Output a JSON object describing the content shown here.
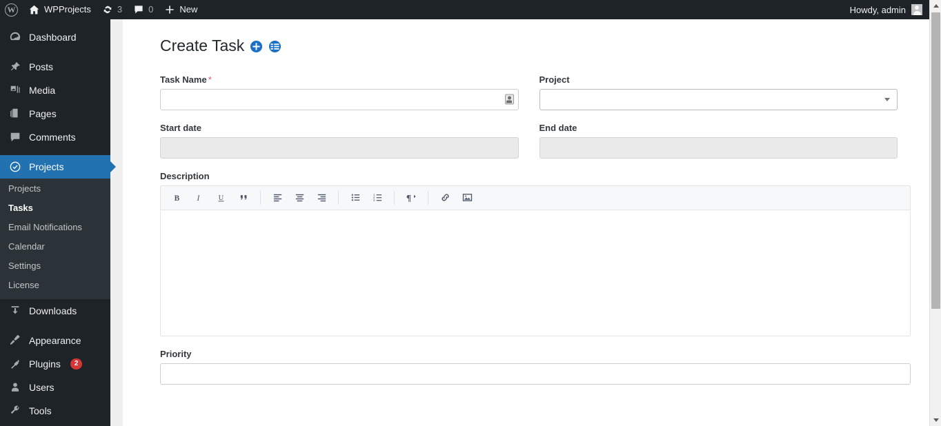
{
  "adminbar": {
    "logo_icon": "wordpress-logo-icon",
    "site_home_icon": "home-icon",
    "site_name": "WPProjects",
    "updates_icon": "updates-icon",
    "updates_count": "3",
    "comments_icon": "comment-bubble-icon",
    "comments_count": "0",
    "new_icon": "plus-icon",
    "new_label": "New",
    "howdy": "Howdy, admin",
    "avatar_icon": "user-avatar-icon"
  },
  "sidebar": {
    "items": [
      {
        "label": "Dashboard",
        "icon": "dashboard-icon",
        "active": false
      },
      {
        "label": "Posts",
        "icon": "pin-icon",
        "active": false
      },
      {
        "label": "Media",
        "icon": "media-icon",
        "active": false
      },
      {
        "label": "Pages",
        "icon": "pages-icon",
        "active": false
      },
      {
        "label": "Comments",
        "icon": "comment-bubble-icon",
        "active": false
      },
      {
        "label": "Projects",
        "icon": "check-circle-icon",
        "active": true
      },
      {
        "label": "Downloads",
        "icon": "download-icon",
        "active": false
      },
      {
        "label": "Appearance",
        "icon": "paintbrush-icon",
        "active": false
      },
      {
        "label": "Plugins",
        "icon": "plug-icon",
        "active": false,
        "badge": "2"
      },
      {
        "label": "Users",
        "icon": "user-icon",
        "active": false
      },
      {
        "label": "Tools",
        "icon": "wrench-icon",
        "active": false
      }
    ],
    "submenu": [
      {
        "label": "Projects",
        "current": false
      },
      {
        "label": "Tasks",
        "current": true
      },
      {
        "label": "Email Notifications",
        "current": false
      },
      {
        "label": "Calendar",
        "current": false
      },
      {
        "label": "Settings",
        "current": false
      },
      {
        "label": "License",
        "current": false
      }
    ]
  },
  "page": {
    "title": "Create Task",
    "title_icons": [
      {
        "name": "add-circle-icon",
        "color": "#1a6fc4"
      },
      {
        "name": "list-circle-icon",
        "color": "#1a6fc4"
      }
    ],
    "accent_color": "#2271b1",
    "required_color": "#e8505b"
  },
  "form": {
    "task_name": {
      "label": "Task Name",
      "required_marker": "*",
      "value": "",
      "placeholder": "",
      "trailing_icon": "autofill-card-icon"
    },
    "project": {
      "label": "Project",
      "value": "",
      "options": [
        ""
      ],
      "chevron_icon": "chevron-down-icon"
    },
    "start_date": {
      "label": "Start date",
      "value": "",
      "placeholder": ""
    },
    "end_date": {
      "label": "End date",
      "value": "",
      "placeholder": ""
    },
    "description": {
      "label": "Description",
      "value": "",
      "toolbar": [
        {
          "name": "bold-icon",
          "glyph": "B"
        },
        {
          "name": "italic-icon",
          "glyph": "I"
        },
        {
          "name": "underline-icon",
          "glyph": "U"
        },
        {
          "name": "blockquote-icon",
          "glyph": "“"
        },
        {
          "name": "align-left-icon",
          "glyph": ""
        },
        {
          "name": "align-center-icon",
          "glyph": ""
        },
        {
          "name": "align-right-icon",
          "glyph": ""
        },
        {
          "name": "bulleted-list-icon",
          "glyph": ""
        },
        {
          "name": "numbered-list-icon",
          "glyph": ""
        },
        {
          "name": "rtl-paragraph-icon",
          "glyph": "¶"
        },
        {
          "name": "link-icon",
          "glyph": ""
        },
        {
          "name": "image-icon",
          "glyph": ""
        }
      ]
    },
    "priority": {
      "label": "Priority",
      "value": "",
      "placeholder": ""
    }
  },
  "scrollbar": {
    "up_icon": "scroll-up-arrow-icon",
    "down_icon": "scroll-down-arrow-icon"
  }
}
